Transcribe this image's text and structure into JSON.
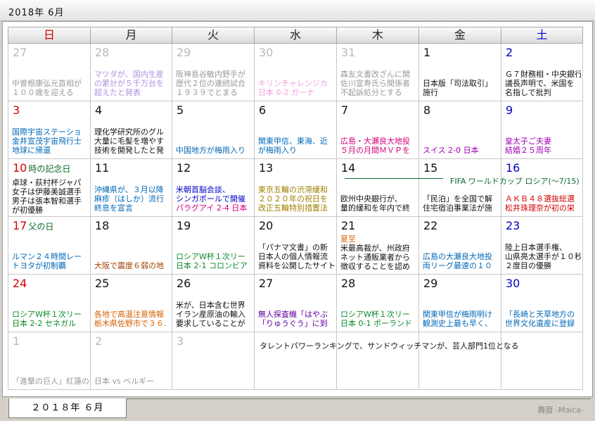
{
  "window": {
    "title": "2018年 6月"
  },
  "weekdays": [
    "日",
    "月",
    "火",
    "水",
    "木",
    "金",
    "土"
  ],
  "weekday_colors": [
    "#d40000",
    "#222222",
    "#222222",
    "#222222",
    "#222222",
    "#222222",
    "#0000c8"
  ],
  "weeks": [
    [
      {
        "day": "27",
        "faded": true,
        "events": [
          {
            "text": "中曽根康弘元首相が",
            "color": "#999"
          },
          {
            "text": "１００歳を迎える",
            "color": "#999"
          }
        ]
      },
      {
        "day": "28",
        "faded": true,
        "events": [
          {
            "text": "マツダが、国内生産",
            "color": "#b090e0"
          },
          {
            "text": "の累計が５千万台を",
            "color": "#b090e0"
          },
          {
            "text": "超えたと発表",
            "color": "#b090e0"
          }
        ]
      },
      {
        "day": "29",
        "faded": true,
        "events": [
          {
            "text": "阪神島谷敏内野手が",
            "color": "#999"
          },
          {
            "text": "歴代２位の連続試合",
            "color": "#999"
          },
          {
            "text": "１９３９でとまる",
            "color": "#999"
          }
        ]
      },
      {
        "day": "30",
        "faded": true,
        "events": [
          {
            "text": "キリンチャレンジカ",
            "color": "#f0a0e0"
          },
          {
            "text": "日本 0-2 ガーナ",
            "color": "#f0a0e0"
          }
        ]
      },
      {
        "day": "31",
        "faded": true,
        "events": [
          {
            "text": "森友文書改ざんに関",
            "color": "#999"
          },
          {
            "text": "佐川宣寿氏ら関係者",
            "color": "#999"
          },
          {
            "text": "不起訴処分とする",
            "color": "#999"
          }
        ]
      },
      {
        "day": "1",
        "faded": false,
        "dcolor": "#111",
        "events": [
          {
            "text": "日本版「司法取引」",
            "color": "#111"
          },
          {
            "text": "施行",
            "color": "#111"
          }
        ]
      },
      {
        "day": "2",
        "faded": false,
        "dcolor": "#0000c8",
        "events": [
          {
            "text": "Ｇ７財務相・中央銀行",
            "color": "#111"
          },
          {
            "text": "議長声明で、米国を",
            "color": "#111"
          },
          {
            "text": "名指しで批判",
            "color": "#111"
          }
        ]
      }
    ],
    [
      {
        "day": "3",
        "dcolor": "#d40000",
        "events": [
          {
            "text": "国際宇宙ステーショ",
            "color": "#0068b8"
          },
          {
            "text": "金井宣茂宇宙飛行士",
            "color": "#0068b8"
          },
          {
            "text": "地球に帰還",
            "color": "#0068b8"
          }
        ]
      },
      {
        "day": "4",
        "dcolor": "#111",
        "events": [
          {
            "text": "理化学研究所のグル",
            "color": "#111"
          },
          {
            "text": "大量に毛髪を増やす",
            "color": "#111"
          },
          {
            "text": "技術を開発したと発",
            "color": "#111"
          }
        ]
      },
      {
        "day": "5",
        "dcolor": "#111",
        "events": [
          {
            "text": "中国地方が梅雨入り",
            "color": "#0068b8"
          }
        ]
      },
      {
        "day": "6",
        "dcolor": "#111",
        "events": [
          {
            "text": "関東甲信、東海、近",
            "color": "#0068b8"
          },
          {
            "text": "が梅雨入り",
            "color": "#0068b8"
          }
        ]
      },
      {
        "day": "7",
        "dcolor": "#111",
        "events": [
          {
            "text": "広島・大瀬良大地投",
            "color": "#d4007a"
          },
          {
            "text": "５月の月間ＭＶＰを",
            "color": "#d4007a"
          }
        ]
      },
      {
        "day": "8",
        "dcolor": "#111",
        "events": [
          {
            "text": "スイス 2-0 日本",
            "color": "#a000b8"
          }
        ]
      },
      {
        "day": "9",
        "dcolor": "#0000c8",
        "events": [
          {
            "text": "皇太子ご夫妻",
            "color": "#a000b8"
          },
          {
            "text": "結婚２５周年",
            "color": "#a000b8"
          }
        ]
      }
    ],
    [
      {
        "day": "10",
        "dcolor": "#d40000",
        "note": "時の記念日",
        "ncolor": "#0b6a2a",
        "events": [
          {
            "text": "卓球・荻村杯ジャパ",
            "color": "#111"
          },
          {
            "text": "女子は伊藤美誠選手",
            "color": "#111"
          },
          {
            "text": "男子は張本智和選手",
            "color": "#111"
          },
          {
            "text": "が初優勝",
            "color": "#111"
          }
        ]
      },
      {
        "day": "11",
        "dcolor": "#111",
        "events": [
          {
            "text": "沖縄県が、３月以降",
            "color": "#0068b8"
          },
          {
            "text": "麻疹（はしか）流行",
            "color": "#0068b8"
          },
          {
            "text": "終息を宣言",
            "color": "#0068b8"
          }
        ]
      },
      {
        "day": "12",
        "dcolor": "#111",
        "events": [
          {
            "text": "米朝首脳会談、",
            "color": "#0000c8"
          },
          {
            "text": "シンガポールで開催",
            "color": "#0000c8"
          },
          {
            "text": "パラグアイ 2-4 日本",
            "color": "#d4007a"
          }
        ]
      },
      {
        "day": "13",
        "dcolor": "#111",
        "events": [
          {
            "text": "東京五輪の渋滞緩和",
            "color": "#a08000"
          },
          {
            "text": "２０２０年の祝日を",
            "color": "#a08000"
          },
          {
            "text": "改正五輪特別措置法",
            "color": "#a08000"
          }
        ]
      },
      {
        "day": "14",
        "dcolor": "#111",
        "events": [
          {
            "text": "欧州中央銀行が、",
            "color": "#111"
          },
          {
            "text": "量的緩和を年内で終",
            "color": "#111"
          }
        ]
      },
      {
        "day": "15",
        "dcolor": "#111",
        "events": [
          {
            "text": "「民泊」を全国で解",
            "color": "#111"
          },
          {
            "text": "住宅宿泊事業法が施",
            "color": "#111"
          }
        ]
      },
      {
        "day": "16",
        "dcolor": "#0000c8",
        "events": [
          {
            "text": "ＡＫＢ４８選抜総選",
            "color": "#d40000"
          },
          {
            "text": "松井珠理奈が初の栄",
            "color": "#d40000"
          }
        ]
      }
    ],
    [
      {
        "day": "17",
        "dcolor": "#d40000",
        "note": "父の日",
        "ncolor": "#0b6a2a",
        "events": [
          {
            "text": "ルマン２４時間レー",
            "color": "#0068b8"
          },
          {
            "text": "トヨタが初制覇",
            "color": "#0068b8"
          }
        ]
      },
      {
        "day": "18",
        "dcolor": "#111",
        "events": [
          {
            "text": "大阪で震度６弱の地",
            "color": "#a04000"
          }
        ]
      },
      {
        "day": "19",
        "dcolor": "#111",
        "events": [
          {
            "text": "ロシアW杯１次リー",
            "color": "#0b8a2a"
          },
          {
            "text": "日本 2-1 コロンビア",
            "color": "#0b8a2a"
          }
        ]
      },
      {
        "day": "20",
        "dcolor": "#111",
        "events": [
          {
            "text": "「パナマ文書」の新",
            "color": "#111"
          },
          {
            "text": "日本人の個人情報流",
            "color": "#111"
          },
          {
            "text": "資料を公開したサイトの会",
            "color": "#111"
          }
        ]
      },
      {
        "day": "21",
        "dcolor": "#111",
        "note2": "夏至",
        "events": [
          {
            "text": "米最高裁が、州政府",
            "color": "#111"
          },
          {
            "text": "ネット通販業者から",
            "color": "#111"
          },
          {
            "text": "徴収することを認め",
            "color": "#111"
          }
        ]
      },
      {
        "day": "22",
        "dcolor": "#111",
        "events": [
          {
            "text": "広島の大瀬良大地投",
            "color": "#0068b8"
          },
          {
            "text": "両リーグ最速の１０",
            "color": "#0068b8"
          }
        ]
      },
      {
        "day": "23",
        "dcolor": "#0000c8",
        "events": [
          {
            "text": "陸上日本選手権、",
            "color": "#111"
          },
          {
            "text": "山県亮太選手が１０秒",
            "color": "#111"
          },
          {
            "text": "２度目の優勝",
            "color": "#111"
          }
        ]
      }
    ],
    [
      {
        "day": "24",
        "dcolor": "#d40000",
        "events": [
          {
            "text": "ロシアW杯１次リー",
            "color": "#0b8a2a"
          },
          {
            "text": "日本 2-2 セネガル",
            "color": "#0b8a2a"
          }
        ]
      },
      {
        "day": "25",
        "dcolor": "#111",
        "events": [
          {
            "text": "各地で高温注意情報",
            "color": "#d46000"
          },
          {
            "text": "栃木県佐野市で３６.",
            "color": "#d46000"
          }
        ]
      },
      {
        "day": "26",
        "dcolor": "#111",
        "events": [
          {
            "text": "米が、日本含む世界",
            "color": "#111"
          },
          {
            "text": "イラン産原油の輸入",
            "color": "#111"
          },
          {
            "text": "要求していることが",
            "color": "#111"
          }
        ]
      },
      {
        "day": "27",
        "dcolor": "#111",
        "events": [
          {
            "text": "無人探査機「はやぶ",
            "color": "#6000a0"
          },
          {
            "text": "「りゅうぐう」に到",
            "color": "#6000a0"
          }
        ]
      },
      {
        "day": "28",
        "dcolor": "#111",
        "events": [
          {
            "text": "ロシアW杯１次リー",
            "color": "#0b8a2a"
          },
          {
            "text": "日本 0-1 ポーランド",
            "color": "#0b8a2a"
          }
        ]
      },
      {
        "day": "29",
        "dcolor": "#111",
        "events": [
          {
            "text": "関東甲信が梅雨明け",
            "color": "#0068b8"
          },
          {
            "text": "観測史上最も早く、",
            "color": "#0068b8"
          }
        ]
      },
      {
        "day": "30",
        "dcolor": "#0000c8",
        "events": [
          {
            "text": "「長崎と天草地方の",
            "color": "#0068b8"
          },
          {
            "text": "世界文化遺産に登録",
            "color": "#0068b8"
          }
        ]
      }
    ],
    [
      {
        "day": "1",
        "faded": true,
        "events": [
          {
            "text": "「進撃の巨人」紅蓮の",
            "color": "#999"
          }
        ]
      },
      {
        "day": "2",
        "faded": true,
        "events": [
          {
            "text": "日本 vs ベルギー",
            "color": "#999"
          }
        ]
      },
      {
        "day": "3",
        "faded": true,
        "events": []
      },
      {
        "day": "",
        "faded": true,
        "events": []
      },
      {
        "day": "",
        "faded": true,
        "events": []
      },
      {
        "day": "",
        "faded": true,
        "events": []
      },
      {
        "day": "",
        "faded": true,
        "events": []
      }
    ]
  ],
  "span_event": "FIFA ワールドカップ ロシア(〜7/15)",
  "long_event": "タレントパワーランキングで、サンドウィッチマンが、芸人部門1位となる",
  "tab": {
    "label": "２０１８年 ６月"
  },
  "brand": "舞暦 -Maica-"
}
